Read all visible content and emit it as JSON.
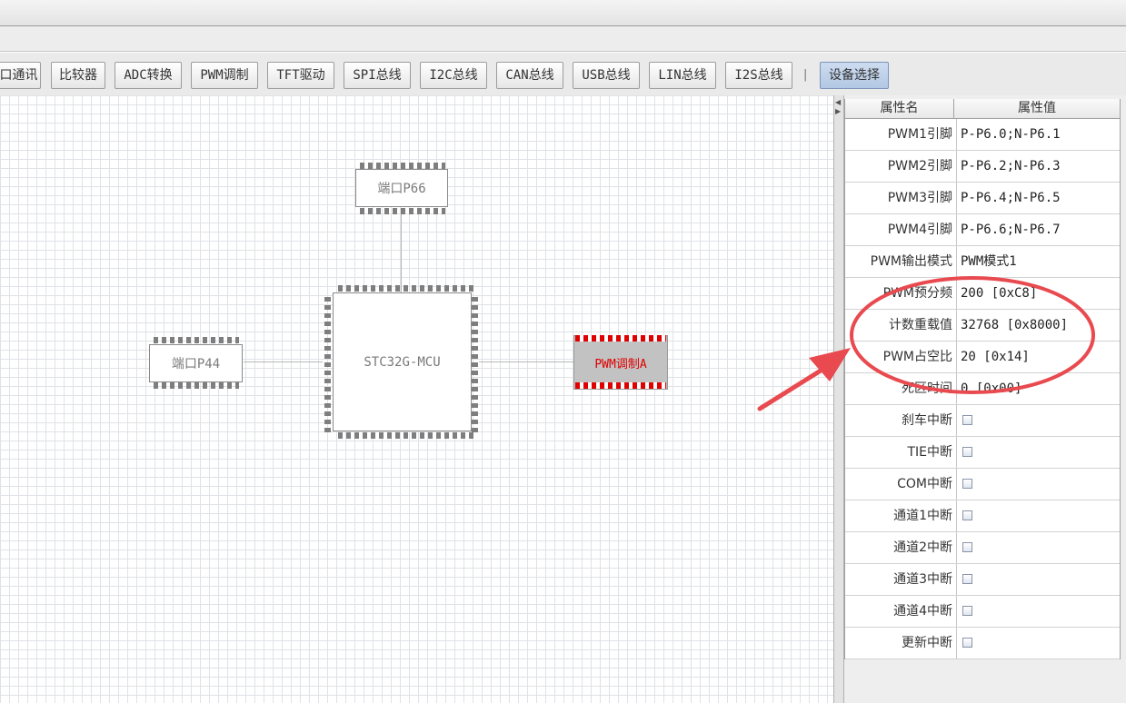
{
  "toolbar": {
    "buttons": [
      {
        "label": "口通讯"
      },
      {
        "label": "比较器"
      },
      {
        "label": "ADC转换"
      },
      {
        "label": "PWM调制"
      },
      {
        "label": "TFT驱动"
      },
      {
        "label": "SPI总线"
      },
      {
        "label": "I2C总线"
      },
      {
        "label": "CAN总线"
      },
      {
        "label": "USB总线"
      },
      {
        "label": "LIN总线"
      },
      {
        "label": "I2S总线"
      },
      {
        "label": "设备选择"
      }
    ],
    "separator": "|"
  },
  "diagram": {
    "mcu_label": "STC32G-MCU",
    "port_top_label": "端口P66",
    "port_left_label": "端口P44",
    "pwm_label": "PWM调制A"
  },
  "properties": {
    "header_name": "属性名",
    "header_value": "属性值",
    "rows": [
      {
        "name": "PWM1引脚",
        "value": "P-P6.0;N-P6.1"
      },
      {
        "name": "PWM2引脚",
        "value": "P-P6.2;N-P6.3"
      },
      {
        "name": "PWM3引脚",
        "value": "P-P6.4;N-P6.5"
      },
      {
        "name": "PWM4引脚",
        "value": "P-P6.6;N-P6.7"
      },
      {
        "name": "PWM输出模式",
        "value": "PWM模式1"
      },
      {
        "name": "PWM预分频",
        "value": "200 [0xC8]"
      },
      {
        "name": "计数重载值",
        "value": "32768 [0x8000]"
      },
      {
        "name": "PWM占空比",
        "value": "20 [0x14]"
      },
      {
        "name": "死区时间",
        "value": "0 [0x00]"
      },
      {
        "name": "刹车中断",
        "value": ""
      },
      {
        "name": "TIE中断",
        "value": ""
      },
      {
        "name": "COM中断",
        "value": ""
      },
      {
        "name": "通道1中断",
        "value": ""
      },
      {
        "name": "通道2中断",
        "value": ""
      },
      {
        "name": "通道3中断",
        "value": ""
      },
      {
        "name": "通道4中断",
        "value": ""
      },
      {
        "name": "更新中断",
        "value": ""
      }
    ]
  },
  "colors": {
    "annotation": "#e84a4f",
    "pwm_highlight": "#e00000",
    "active_button": "#b3c8e4"
  }
}
